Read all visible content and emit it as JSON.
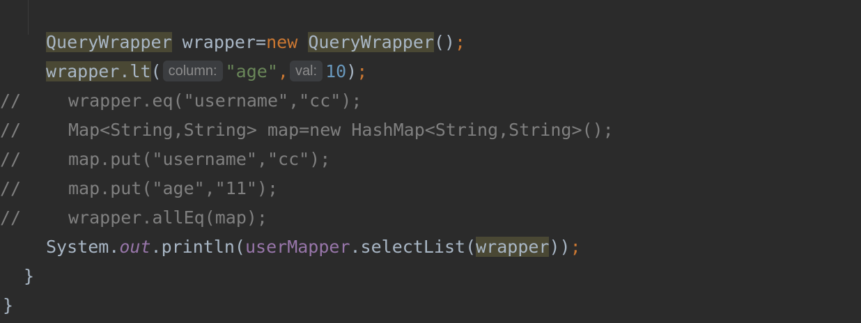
{
  "editor": {
    "line1": {
      "type1": "QueryWrapper",
      "var": " wrapper=",
      "kw_new": "new",
      "space": " ",
      "type2": "QueryWrapper",
      "parens": "()",
      "semi": ";"
    },
    "line2": {
      "call": "wrapper.lt",
      "open": "(",
      "hint_column": "column:",
      "str_age": "\"age\"",
      "comma": ",",
      "hint_val": "val:",
      "num": "10",
      "close": ")",
      "semi": ";"
    },
    "commented_lines": [
      {
        "marker": "//",
        "code": "wrapper.eq(\"username\",\"cc\");"
      },
      {
        "marker": "//",
        "code": "Map<String,String> map=new HashMap<String,String>();"
      },
      {
        "marker": "//",
        "code": "map.put(\"username\",\"cc\");"
      },
      {
        "marker": "//",
        "code": "map.put(\"age\",\"11\");"
      },
      {
        "marker": "//",
        "code": "wrapper.allEq(map);"
      }
    ],
    "line8": {
      "system": "System.",
      "out": "out",
      "println": ".println(",
      "mapper": "userMapper",
      "select": ".selectList(",
      "arg": "wrapper",
      "close": "))",
      "semi": ";"
    },
    "close_method": "}",
    "close_class": "}"
  }
}
